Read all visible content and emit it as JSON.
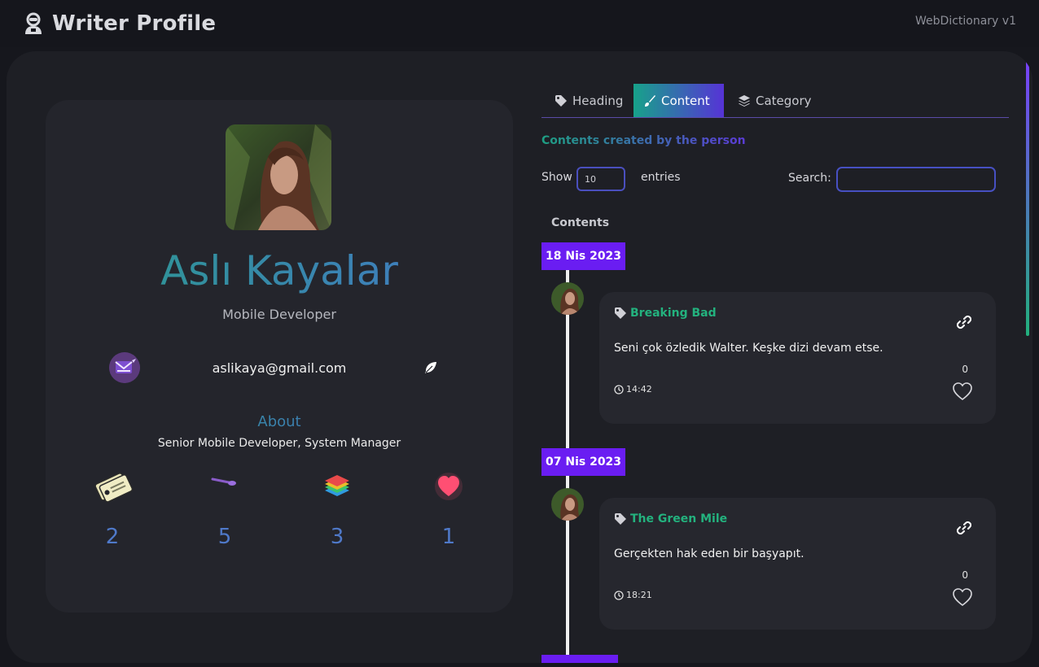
{
  "header": {
    "title": "Writer Profile",
    "version": "WebDictionary v1"
  },
  "profile": {
    "name": "Aslı Kayalar",
    "role": "Mobile Developer",
    "email": "aslikaya@gmail.com",
    "about_title": "About",
    "about_text": "Senior Mobile Developer, System Manager",
    "stats": [
      {
        "icon": "tags-icon",
        "value": "2"
      },
      {
        "icon": "brush-icon",
        "value": "5"
      },
      {
        "icon": "layers-icon",
        "value": "3"
      },
      {
        "icon": "heart-icon",
        "value": "1"
      }
    ]
  },
  "tabs": [
    {
      "label": "Heading",
      "icon": "tag-icon"
    },
    {
      "label": "Content",
      "icon": "brush-icon",
      "active": true
    },
    {
      "label": "Category",
      "icon": "layers-icon"
    }
  ],
  "content_section": {
    "subtitle": "Contents created by the person",
    "show_label": "Show",
    "show_value": "10",
    "entries_label": "entries",
    "search_label": "Search:",
    "search_value": "",
    "column_header": "Contents"
  },
  "posts": [
    {
      "date": "18 Nis 2023",
      "title": "Breaking Bad",
      "text": "Seni çok özledik Walter. Keşke dizi devam etse.",
      "time": "14:42",
      "likes": "0"
    },
    {
      "date": "07 Nis 2023",
      "title": "The Green Mile",
      "text": "Gerçekten hak eden bir başyapıt.",
      "time": "18:21",
      "likes": "0"
    }
  ],
  "colors": {
    "accent_purple": "#6a1df2",
    "accent_teal": "#23b27e",
    "name_gradient_start": "#2a9b8b",
    "name_gradient_end": "#4476c9"
  }
}
